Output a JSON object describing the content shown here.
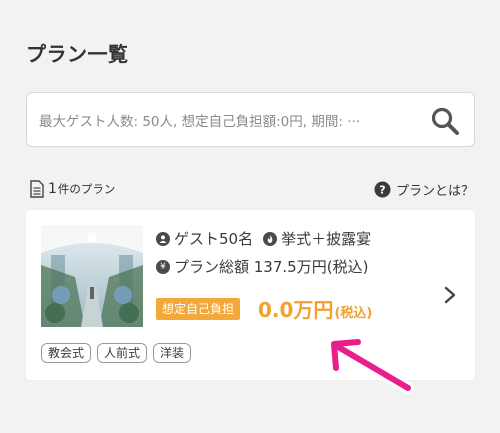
{
  "page_title": "プラン一覧",
  "search": {
    "placeholder": "最大ゲスト人数: 50人, 想定自己負担額:0円, 期間: ···"
  },
  "results": {
    "count": "1",
    "count_suffix": "件のプラン"
  },
  "help": {
    "label": "プランとは？"
  },
  "plan": {
    "guest_text": "ゲスト50名",
    "ceremony_text": "挙式＋披露宴",
    "total_text": "プラン総額 137.5万円(税込)",
    "self_pay_badge": "想定自己負担",
    "self_pay_amount": "0.0万円",
    "self_pay_tax": "(税込)",
    "tags": [
      "教会式",
      "人前式",
      "洋装"
    ]
  },
  "colors": {
    "accent": "#f0a22c",
    "badge": "#f3a93a",
    "annotation_arrow": "#e91e8c"
  },
  "icons": [
    "search-icon",
    "document-icon",
    "help-circle-icon",
    "person-icon",
    "fire-icon",
    "yen-icon",
    "chevron-right-icon"
  ]
}
